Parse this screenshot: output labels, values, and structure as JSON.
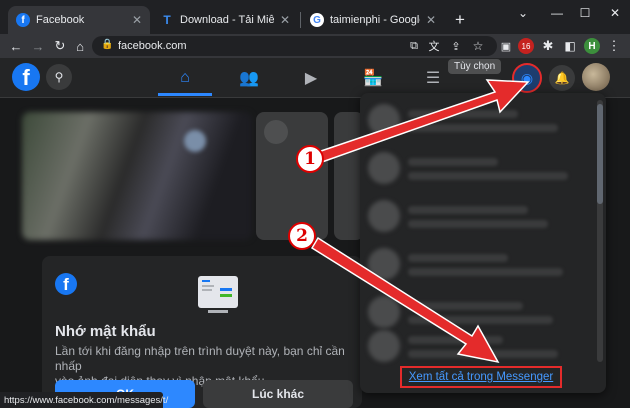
{
  "browser": {
    "tabs": [
      {
        "title": "Facebook",
        "active": true,
        "favicon_color": "#1877f2",
        "favicon_letter": "f"
      },
      {
        "title": "Download - Tải Miễn Phí VN",
        "active": false,
        "favicon_color": "#1a73e8",
        "favicon_letter": "T"
      },
      {
        "title": "taimienphi - Google Search",
        "active": false,
        "favicon_color": "#ffffff",
        "favicon_letter": "G"
      }
    ],
    "new_tab": "+",
    "url": "facebook.com",
    "profile_initial": "H",
    "extension_badge": "16",
    "status_url": "https://www.facebook.com/messages/t/"
  },
  "facebook": {
    "logo_letter": "f",
    "tooltip": "Tùy chọn",
    "nav": [
      "home-icon",
      "friends-icon",
      "watch-icon",
      "marketplace-icon",
      "menu-icon"
    ],
    "accent": "#2d88ff"
  },
  "card": {
    "logo_letter": "f",
    "title": "Nhớ mật khẩu",
    "description": "Lần tới khi đăng nhập trên trình duyệt này, bạn chỉ cần nhấp\nvào ảnh đại diện thay vì nhập mật khẩu.",
    "ok_label": "OK",
    "later_label": "Lúc khác"
  },
  "messenger": {
    "see_all": "Xem tất cả trong Messenger"
  },
  "annotations": {
    "step1": "1",
    "step2": "2",
    "color": "#e42b2b"
  }
}
